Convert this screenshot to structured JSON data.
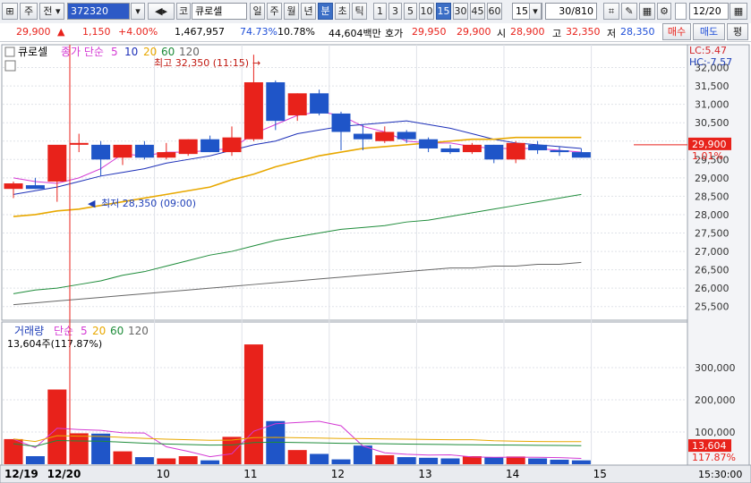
{
  "toolbar": {
    "market_label": "주",
    "prev_label": "전",
    "code_value": "372320",
    "code_type_label": "코",
    "stock_name": "큐로셀",
    "period_buttons": [
      "일",
      "주",
      "월",
      "년",
      "분",
      "초",
      "틱"
    ],
    "interval_buttons": [
      "1",
      "3",
      "5",
      "10",
      "15",
      "30",
      "45",
      "60"
    ],
    "interval_value": "15",
    "count_value": "30/810",
    "date_value": "12/20",
    "active_period": "분",
    "active_interval": "15"
  },
  "quote": {
    "price": "29,900",
    "change": "1,150",
    "change_pct": "+4.00%",
    "volume": "1,467,957",
    "volume_ratio": "74.73%",
    "turnover": "10.78%",
    "trade_value": "44,604백만",
    "ask_label": "호가",
    "ask_sell": "29,950",
    "ask_buy": "29,900",
    "open_label": "시",
    "open": "28,900",
    "high_label": "고",
    "high": "32,350",
    "low_label": "저",
    "low": "28,350",
    "buy_button": "매수",
    "sell_button": "매도",
    "avg_button": "평"
  },
  "price_pane": {
    "title_name": "큐로셀",
    "legend_label": "종가 단순",
    "ma_periods": [
      "5",
      "10",
      "20",
      "60",
      "120"
    ],
    "ma_colors": [
      "#d43ad4",
      "#1c2fb8",
      "#e8a800",
      "#1e8c3a",
      "#666666"
    ],
    "lc": "LC:5.47",
    "hc": "HC:-7.57",
    "high_note": "최고 32,350 (11:15)",
    "low_note": "최저 28,350 (09:00)",
    "current_price_tag": "29,900",
    "current_pct_tag": "1.01%",
    "y_ticks": [
      "32,000",
      "31,500",
      "31,000",
      "30,500",
      "30,000",
      "29,500",
      "29,000",
      "28,500",
      "28,000",
      "27,500",
      "27,000",
      "26,500",
      "26,000",
      "25,500"
    ]
  },
  "volume_pane": {
    "title": "거래량",
    "legend_label": "단순",
    "ma_periods": [
      "5",
      "20",
      "60",
      "120"
    ],
    "current_text": "13,604주(117.87%)",
    "current_tag": "13,604",
    "current_pct_tag": "117.87%",
    "y_ticks": [
      "300,000",
      "200,000",
      "100,000"
    ]
  },
  "x_axis": {
    "labels": [
      "12/19",
      "12/20",
      "10",
      "11",
      "12",
      "13",
      "14",
      "15"
    ],
    "time_label": "15:30:00"
  },
  "chart_data": {
    "type": "candlestick",
    "candles": [
      {
        "o": 28700,
        "h": 28900,
        "l": 28450,
        "c": 28850
      },
      {
        "o": 28800,
        "h": 29000,
        "l": 28700,
        "c": 28700
      },
      {
        "o": 28900,
        "h": 29650,
        "l": 28350,
        "c": 29900
      },
      {
        "o": 29900,
        "h": 30200,
        "l": 29700,
        "c": 29950
      },
      {
        "o": 29900,
        "h": 30000,
        "l": 29050,
        "c": 29500
      },
      {
        "o": 29550,
        "h": 29850,
        "l": 29350,
        "c": 29900
      },
      {
        "o": 29900,
        "h": 30000,
        "l": 29500,
        "c": 29550
      },
      {
        "o": 29550,
        "h": 29950,
        "l": 29500,
        "c": 29700
      },
      {
        "o": 29650,
        "h": 30050,
        "l": 29600,
        "c": 30050
      },
      {
        "o": 30050,
        "h": 30150,
        "l": 29700,
        "c": 29700
      },
      {
        "o": 29700,
        "h": 30400,
        "l": 29600,
        "c": 30100
      },
      {
        "o": 30050,
        "h": 32350,
        "l": 30000,
        "c": 31600
      },
      {
        "o": 31600,
        "h": 31650,
        "l": 30300,
        "c": 30550
      },
      {
        "o": 30700,
        "h": 31300,
        "l": 30550,
        "c": 31300
      },
      {
        "o": 31300,
        "h": 31400,
        "l": 30700,
        "c": 30750
      },
      {
        "o": 30750,
        "h": 30800,
        "l": 29750,
        "c": 30250
      },
      {
        "o": 30200,
        "h": 30450,
        "l": 29750,
        "c": 30050
      },
      {
        "o": 30000,
        "h": 30400,
        "l": 29950,
        "c": 30250
      },
      {
        "o": 30250,
        "h": 30300,
        "l": 29950,
        "c": 30050
      },
      {
        "o": 30050,
        "h": 30100,
        "l": 29700,
        "c": 29800
      },
      {
        "o": 29800,
        "h": 29900,
        "l": 29650,
        "c": 29700
      },
      {
        "o": 29700,
        "h": 29950,
        "l": 29650,
        "c": 29900
      },
      {
        "o": 29900,
        "h": 29900,
        "l": 29400,
        "c": 29500
      },
      {
        "o": 29500,
        "h": 30000,
        "l": 29400,
        "c": 29950
      },
      {
        "o": 29900,
        "h": 30000,
        "l": 29650,
        "c": 29750
      },
      {
        "o": 29750,
        "h": 29850,
        "l": 29600,
        "c": 29700
      },
      {
        "o": 29700,
        "h": 29800,
        "l": 29550,
        "c": 29550
      }
    ],
    "volumes": [
      78000,
      25000,
      232000,
      96000,
      95000,
      40000,
      22000,
      18000,
      25000,
      12000,
      85000,
      372000,
      134000,
      44000,
      32000,
      15000,
      58000,
      28000,
      22000,
      20000,
      18000,
      25000,
      22000,
      24000,
      18000,
      14000,
      12000
    ],
    "ma_lines": [
      {
        "name": "5",
        "values": [
          29000,
          28900,
          28850,
          29000,
          29250,
          29650,
          29600,
          29700,
          29700,
          29750,
          29800,
          30200,
          30450,
          30700,
          30800,
          30700,
          30400,
          30250,
          30000,
          29950,
          29950,
          29850,
          29800,
          29800,
          29800,
          29750,
          29700
        ]
      },
      {
        "name": "10",
        "values": [
          28550,
          28650,
          28750,
          28900,
          29050,
          29150,
          29250,
          29400,
          29500,
          29600,
          29750,
          29900,
          30000,
          30200,
          30300,
          30400,
          30450,
          30500,
          30550,
          30450,
          30350,
          30200,
          30050,
          29950,
          29900,
          29850,
          29800
        ]
      },
      {
        "name": "20",
        "values": [
          27950,
          28000,
          28100,
          28150,
          28250,
          28350,
          28450,
          28550,
          28650,
          28750,
          28950,
          29100,
          29300,
          29450,
          29600,
          29700,
          29800,
          29850,
          29900,
          29950,
          30000,
          30050,
          30050,
          30100,
          30100,
          30100,
          30100
        ]
      },
      {
        "name": "60",
        "values": [
          25850,
          25950,
          26000,
          26100,
          26200,
          26350,
          26450,
          26600,
          26750,
          26900,
          27000,
          27150,
          27300,
          27400,
          27500,
          27600,
          27650,
          27700,
          27800,
          27850,
          27950,
          28050,
          28150,
          28250,
          28350,
          28450,
          28550
        ]
      },
      {
        "name": "120",
        "values": [
          25550,
          25600,
          25650,
          25700,
          25750,
          25800,
          25850,
          25900,
          25950,
          26000,
          26050,
          26100,
          26150,
          26200,
          26250,
          26300,
          26350,
          26400,
          26450,
          26500,
          26550,
          26550,
          26600,
          26600,
          26650,
          26650,
          26700
        ]
      }
    ],
    "ylim": [
      25250,
      32500
    ],
    "volume_ylim": [
      0,
      400000
    ]
  }
}
